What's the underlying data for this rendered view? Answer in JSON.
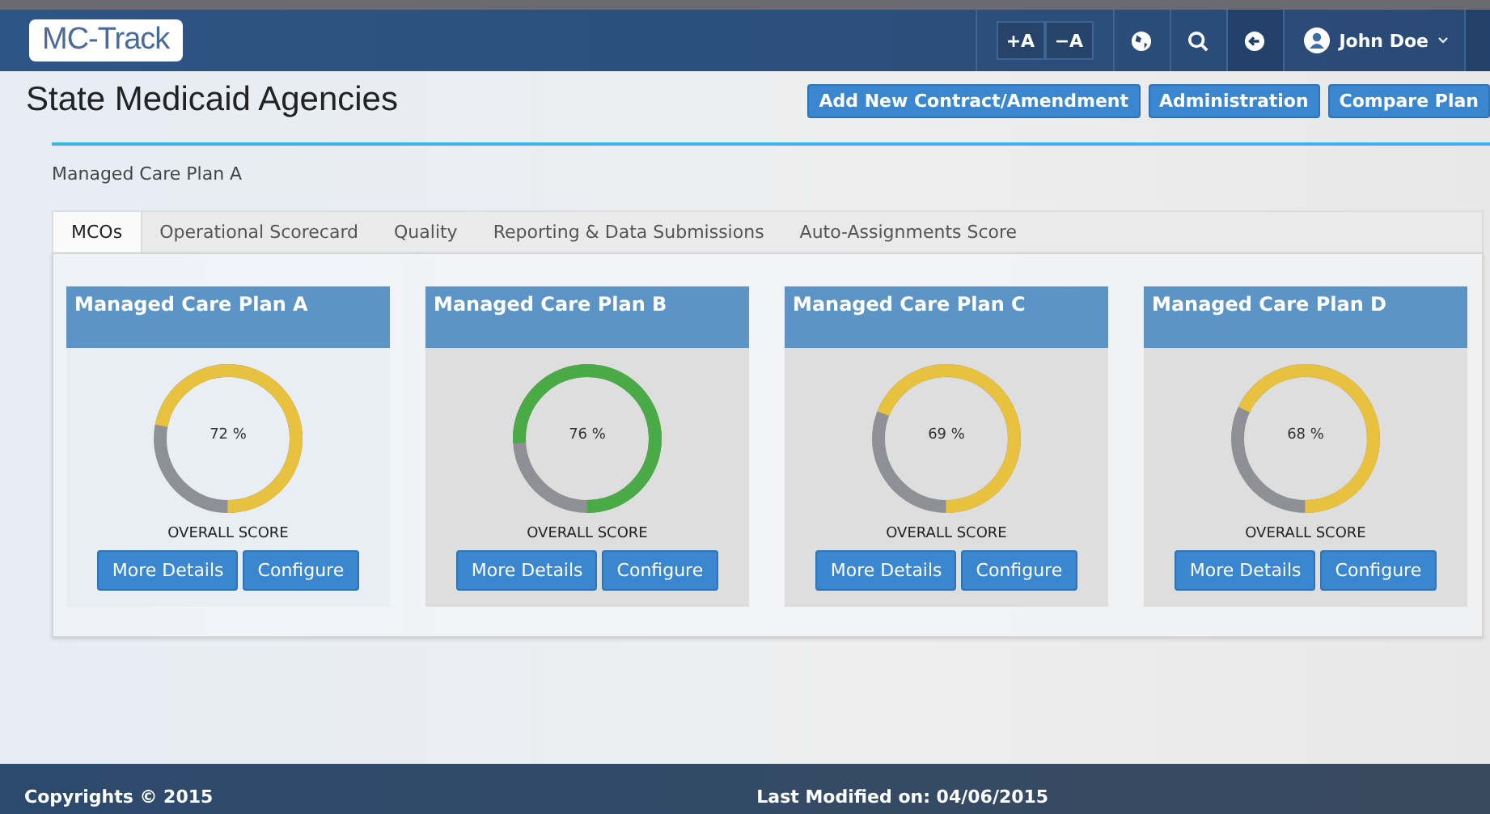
{
  "header": {
    "logo": "MC-Track",
    "font_buttons": [
      "+A",
      "−A"
    ],
    "user": "John Doe"
  },
  "title": "State Medicaid Agencies",
  "actions": [
    "Add New Contract/Amendment",
    "Administration",
    "Compare Plan"
  ],
  "breadcrumb": "Managed Care Plan A",
  "tabs": [
    {
      "label": "MCOs",
      "selected": true
    },
    {
      "label": "Operational Scorecard",
      "selected": false
    },
    {
      "label": "Quality",
      "selected": false
    },
    {
      "label": "Reporting & Data Submissions",
      "selected": false
    },
    {
      "label": "Auto-Assignments Score",
      "selected": false
    }
  ],
  "plans": [
    {
      "name": "Managed Care Plan A",
      "level": 0.72,
      "reading": "72 %",
      "color": "#e8c23e",
      "caption": "OVERALL SCORE",
      "buttons": [
        "More Details",
        "Configure"
      ]
    },
    {
      "name": "Managed Care Plan B",
      "level": 0.76,
      "reading": "76 %",
      "color": "#4aab46",
      "caption": "OVERALL SCORE",
      "buttons": [
        "More Details",
        "Configure"
      ]
    },
    {
      "name": "Managed Care Plan C",
      "level": 0.69,
      "reading": "69 %",
      "color": "#e8c23e",
      "caption": "OVERALL SCORE",
      "buttons": [
        "More Details",
        "Configure"
      ]
    },
    {
      "name": "Managed Care Plan D",
      "level": 0.68,
      "reading": "68 %",
      "color": "#e8c23e",
      "caption": "OVERALL SCORE",
      "buttons": [
        "More Details",
        "Configure"
      ]
    }
  ],
  "footer": {
    "copyright": "Copyrights © 2015",
    "modified": "Last Modified on: 04/06/2015"
  }
}
